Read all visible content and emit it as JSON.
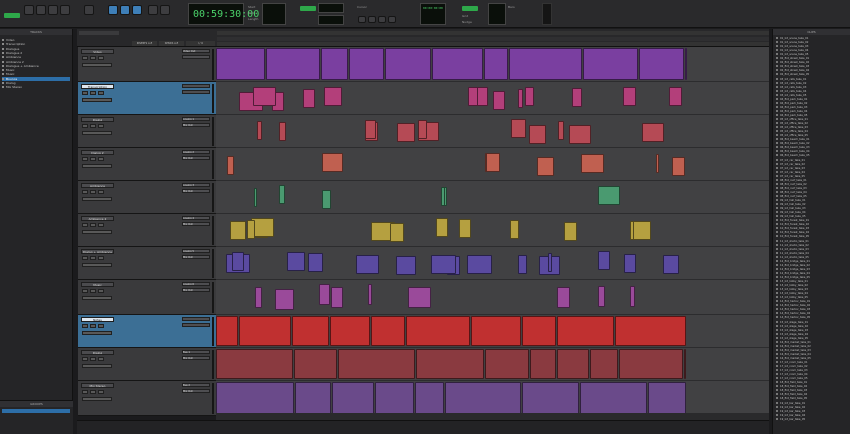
{
  "toolbar": {
    "counter_main": "00:59:30:00",
    "labels": [
      "Start",
      "End",
      "Length",
      "Cursor",
      "Grid",
      "Nudge",
      "Bars"
    ],
    "secondary_counter": "00:00:00:00"
  },
  "tracks_panel": {
    "title": "TRACKS",
    "items": [
      "Video",
      "Transcription",
      "Dialogue",
      "Dialogue 2",
      "Ambience",
      "Ambience 2",
      "Dialogue + Ambience",
      "Music",
      "Music",
      "Bounce",
      "Dialog",
      "Mix Stereo"
    ],
    "selected_index": 9
  },
  "groups_panel": {
    "title": "GROUPS"
  },
  "ruler": {
    "column_headers": [
      "INSERTS A-E",
      "SENDS A-E",
      "I / O"
    ]
  },
  "tracks": [
    {
      "name": "Video",
      "io_top": "Video Out",
      "io_bottom": "",
      "selected": false,
      "height": 35,
      "color": "#7a3fa0"
    },
    {
      "name": "Transcription",
      "io_top": "",
      "io_bottom": "",
      "selected": true,
      "height": 33,
      "color": "#b33f7a"
    },
    {
      "name": "Dialog",
      "io_top": "Analog 1",
      "io_bottom": "Mix Out",
      "selected": false,
      "height": 33,
      "color": "#b54a55"
    },
    {
      "name": "Dialog 2",
      "io_top": "Analog 2",
      "io_bottom": "Mix Out",
      "selected": false,
      "height": 33,
      "color": "#c06050"
    },
    {
      "name": "Ambience",
      "io_top": "Analog 3",
      "io_bottom": "Mix Out",
      "selected": false,
      "height": 33,
      "color": "#4a9a70"
    },
    {
      "name": "Ambience 2",
      "io_top": "Analog 4",
      "io_bottom": "Mix Out",
      "selected": false,
      "height": 33,
      "color": "#b5a040"
    },
    {
      "name": "Dialog + Ambience",
      "io_top": "Analog 5",
      "io_bottom": "Mix Out",
      "selected": false,
      "height": 33,
      "color": "#5a4aa0"
    },
    {
      "name": "Music",
      "io_top": "Analog 6",
      "io_bottom": "Mix Out",
      "selected": false,
      "height": 35,
      "color": "#9a4a9a"
    },
    {
      "name": "Notes",
      "io_top": "",
      "io_bottom": "",
      "selected": true,
      "height": 33,
      "color": "#c03030"
    },
    {
      "name": "Dialog",
      "io_top": "Bus 1",
      "io_bottom": "Mix Out",
      "selected": false,
      "height": 33,
      "color": "#8a3a40"
    },
    {
      "name": "Mix Stereo",
      "io_top": "Bus 2",
      "io_bottom": "Mix Out",
      "selected": false,
      "height": 35,
      "color": "#6a4a8a"
    }
  ],
  "clips_panel": {
    "title": "CLIPS",
    "items": [
      "01_Int_scene_take_01",
      "01_Int_scene_take_02",
      "01_Int_scene_take_03",
      "01_Int_scene_take_04",
      "01_Int_scene_take_05",
      "02_Ext_street_take_01",
      "02_Ext_street_take_02",
      "02_Ext_street_take_03",
      "02_Ext_street_take_04",
      "02_Ext_street_take_05",
      "03_Int_cafe_take_01",
      "03_Int_cafe_take_02",
      "03_Int_cafe_take_03",
      "03_Int_cafe_take_04",
      "03_Int_cafe_take_05",
      "04_Ext_park_take_01",
      "04_Ext_park_take_02",
      "04_Ext_park_take_03",
      "04_Ext_park_take_04",
      "04_Ext_park_take_05",
      "05_Int_office_take_01",
      "05_Int_office_take_02",
      "05_Int_office_take_03",
      "05_Int_office_take_04",
      "05_Int_office_take_05",
      "06_Ext_beach_take_01",
      "06_Ext_beach_take_02",
      "06_Ext_beach_take_03",
      "06_Ext_beach_take_04",
      "06_Ext_beach_take_05",
      "07_Int_car_take_01",
      "07_Int_car_take_02",
      "07_Int_car_take_03",
      "07_Int_car_take_04",
      "07_Int_car_take_05",
      "08_Ext_roof_take_01",
      "08_Ext_roof_take_02",
      "08_Ext_roof_take_03",
      "08_Ext_roof_take_04",
      "08_Ext_roof_take_05",
      "09_Int_hall_take_01",
      "09_Int_hall_take_02",
      "09_Int_hall_take_03",
      "09_Int_hall_take_04",
      "09_Int_hall_take_05",
      "10_Ext_forest_take_01",
      "10_Ext_forest_take_02",
      "10_Ext_forest_take_03",
      "10_Ext_forest_take_04",
      "10_Ext_forest_take_05",
      "11_Int_studio_take_01",
      "11_Int_studio_take_02",
      "11_Int_studio_take_03",
      "11_Int_studio_take_04",
      "11_Int_studio_take_05",
      "12_Ext_bridge_take_01",
      "12_Ext_bridge_take_02",
      "12_Ext_bridge_take_03",
      "12_Ext_bridge_take_04",
      "12_Ext_bridge_take_05",
      "13_Int_lobby_take_01",
      "13_Int_lobby_take_02",
      "13_Int_lobby_take_03",
      "13_Int_lobby_take_04",
      "13_Int_lobby_take_05",
      "14_Ext_harbor_take_01",
      "14_Ext_harbor_take_02",
      "14_Ext_harbor_take_03",
      "14_Ext_harbor_take_04",
      "14_Ext_harbor_take_05",
      "15_Int_stage_take_01",
      "15_Int_stage_take_02",
      "15_Int_stage_take_03",
      "15_Int_stage_take_04",
      "15_Int_stage_take_05",
      "16_Ext_market_take_01",
      "16_Ext_market_take_02",
      "16_Ext_market_take_03",
      "16_Ext_market_take_04",
      "16_Ext_market_take_05",
      "17_Int_room_take_01",
      "17_Int_room_take_02",
      "17_Int_room_take_03",
      "17_Int_room_take_04",
      "17_Int_room_take_05",
      "18_Ext_field_take_01",
      "18_Ext_field_take_02",
      "18_Ext_field_take_03",
      "18_Ext_field_take_04",
      "18_Ext_field_take_05",
      "19_Int_bar_take_01",
      "19_Int_bar_take_02",
      "19_Int_bar_take_03",
      "19_Int_bar_take_04",
      "19_Int_bar_take_05"
    ]
  },
  "colors": {
    "selection": "#2d6ea7",
    "counter_text": "#4bd36a",
    "timeline_bg": "#414143"
  }
}
